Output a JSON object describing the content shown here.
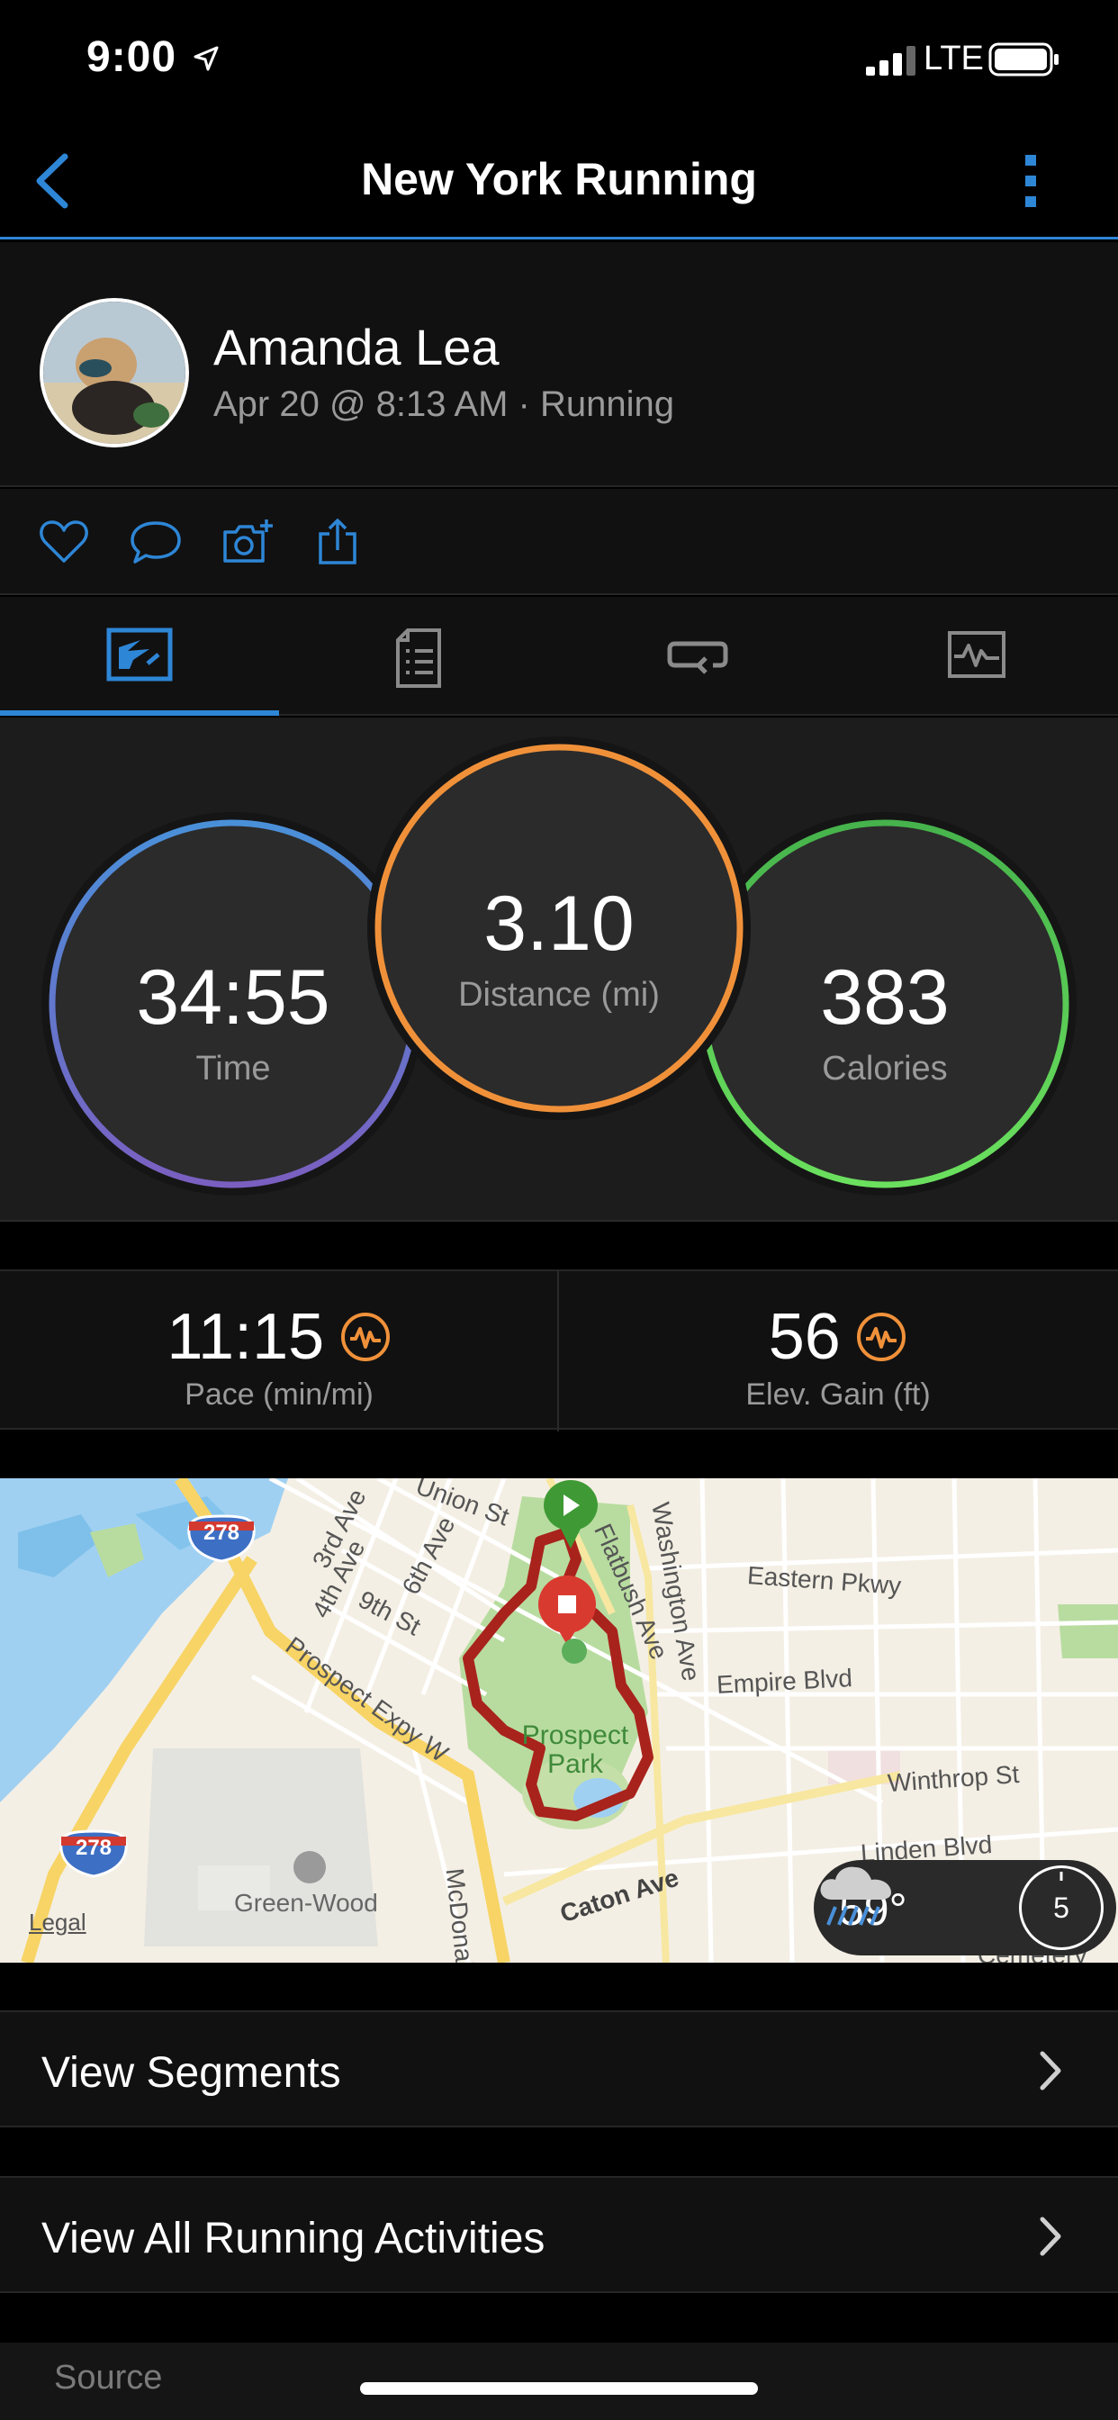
{
  "status_bar": {
    "time": "9:00",
    "network": "LTE"
  },
  "nav": {
    "title": "New York Running"
  },
  "profile": {
    "name": "Amanda Lea",
    "meta": "Apr 20 @ 8:13 AM · Running"
  },
  "actions": {
    "icons": [
      "heart-icon",
      "comment-icon",
      "camera-plus-icon",
      "share-icon"
    ]
  },
  "tabs": {
    "items": [
      "map-tab",
      "details-tab",
      "laps-tab",
      "charts-tab"
    ],
    "active_index": 0
  },
  "rings": {
    "time": {
      "value": "34:55",
      "label": "Time"
    },
    "distance": {
      "value": "3.10",
      "label": "Distance (mi)"
    },
    "calories": {
      "value": "383",
      "label": "Calories"
    }
  },
  "metrics": {
    "pace": {
      "value": "11:15",
      "label": "Pace (min/mi)"
    },
    "elevation": {
      "value": "56",
      "label": "Elev. Gain (ft)"
    }
  },
  "map": {
    "labels": {
      "union_st": "Union St",
      "third_ave": "3rd Ave",
      "fourth_ave": "4th Ave",
      "sixth_ave": "6th Ave",
      "ninth_st": "9th St",
      "prospect_expy": "Prospect Expy W",
      "flatbush": "Flatbush Ave",
      "washington": "Washington Ave",
      "eastern_pkwy": "Eastern Pkwy",
      "empire_blvd": "Empire Blvd",
      "winthrop_st": "Winthrop St",
      "linden_blvd": "Linden Blvd",
      "caton_ave": "Caton Ave",
      "prospect_park": "Prospect Park",
      "green_wood": "Green-Wood",
      "mcdonald": "McDonald",
      "legal": "Legal",
      "interstate": "278",
      "cemetery": "Cemetery"
    },
    "weather": {
      "temp": "59°",
      "wind": "5"
    }
  },
  "rows": {
    "segments": "View Segments",
    "all_activities": "View All Running Activities"
  },
  "source": {
    "label": "Source"
  },
  "colors": {
    "accent_blue": "#2e86d6",
    "ring_time_start": "#4a90d9",
    "ring_time_end": "#7a5fc0",
    "ring_distance": "#f0913a",
    "ring_calories": "#5ed15e",
    "metric_icon": "#f0913a",
    "route": "#a8231c"
  }
}
